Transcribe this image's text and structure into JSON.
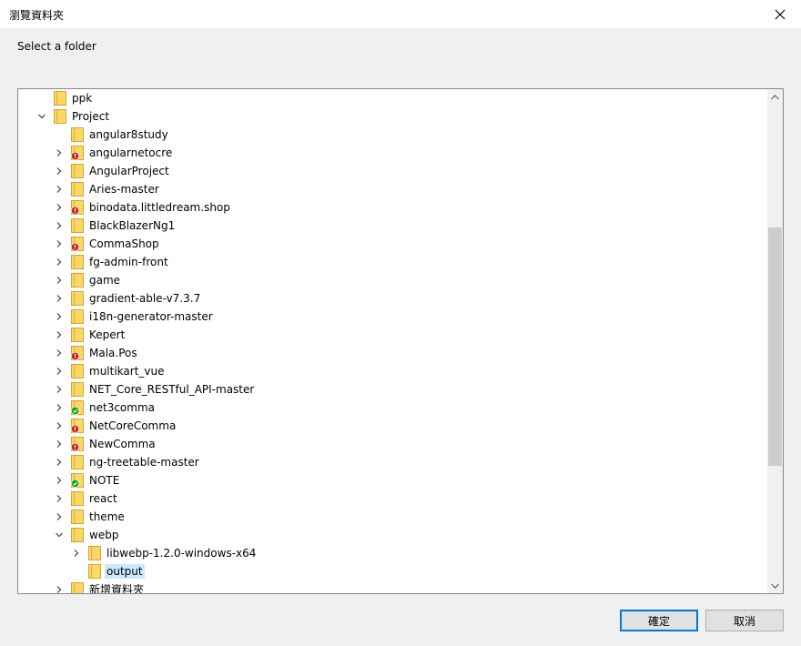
{
  "window": {
    "title": "瀏覽資料夾",
    "prompt": "Select a folder"
  },
  "tree": {
    "items": [
      {
        "label": "ppk",
        "depth": 0,
        "chevron": "none",
        "badge": "none",
        "selected": false
      },
      {
        "label": "Project",
        "depth": 0,
        "chevron": "down",
        "badge": "none",
        "selected": false
      },
      {
        "label": "angular8study",
        "depth": 1,
        "chevron": "none",
        "badge": "none",
        "selected": false
      },
      {
        "label": "angularnetocre",
        "depth": 1,
        "chevron": "right",
        "badge": "error",
        "selected": false
      },
      {
        "label": "AngularProject",
        "depth": 1,
        "chevron": "right",
        "badge": "none",
        "selected": false
      },
      {
        "label": "Aries-master",
        "depth": 1,
        "chevron": "right",
        "badge": "none",
        "selected": false
      },
      {
        "label": "binodata.littledream.shop",
        "depth": 1,
        "chevron": "right",
        "badge": "error",
        "selected": false
      },
      {
        "label": "BlackBlazerNg1",
        "depth": 1,
        "chevron": "right",
        "badge": "none",
        "selected": false
      },
      {
        "label": "CommaShop",
        "depth": 1,
        "chevron": "right",
        "badge": "error",
        "selected": false
      },
      {
        "label": "fg-admin-front",
        "depth": 1,
        "chevron": "right",
        "badge": "none",
        "selected": false
      },
      {
        "label": "game",
        "depth": 1,
        "chevron": "right",
        "badge": "none",
        "selected": false
      },
      {
        "label": "gradient-able-v7.3.7",
        "depth": 1,
        "chevron": "right",
        "badge": "none",
        "selected": false
      },
      {
        "label": "i18n-generator-master",
        "depth": 1,
        "chevron": "right",
        "badge": "none",
        "selected": false
      },
      {
        "label": "Kepert",
        "depth": 1,
        "chevron": "right",
        "badge": "none",
        "selected": false
      },
      {
        "label": "Mala.Pos",
        "depth": 1,
        "chevron": "right",
        "badge": "error",
        "selected": false
      },
      {
        "label": "multikart_vue",
        "depth": 1,
        "chevron": "right",
        "badge": "none",
        "selected": false
      },
      {
        "label": "NET_Core_RESTful_API-master",
        "depth": 1,
        "chevron": "right",
        "badge": "none",
        "selected": false
      },
      {
        "label": "net3comma",
        "depth": 1,
        "chevron": "right",
        "badge": "ok",
        "selected": false
      },
      {
        "label": "NetCoreComma",
        "depth": 1,
        "chevron": "right",
        "badge": "error",
        "selected": false
      },
      {
        "label": "NewComma",
        "depth": 1,
        "chevron": "right",
        "badge": "error",
        "selected": false
      },
      {
        "label": "ng-treetable-master",
        "depth": 1,
        "chevron": "right",
        "badge": "none",
        "selected": false
      },
      {
        "label": "NOTE",
        "depth": 1,
        "chevron": "right",
        "badge": "ok",
        "selected": false
      },
      {
        "label": "react",
        "depth": 1,
        "chevron": "right",
        "badge": "none",
        "selected": false
      },
      {
        "label": "theme",
        "depth": 1,
        "chevron": "right",
        "badge": "none",
        "selected": false
      },
      {
        "label": "webp",
        "depth": 1,
        "chevron": "down",
        "badge": "none",
        "selected": false
      },
      {
        "label": "libwebp-1.2.0-windows-x64",
        "depth": 2,
        "chevron": "right",
        "badge": "none",
        "selected": false
      },
      {
        "label": "output",
        "depth": 2,
        "chevron": "none",
        "badge": "none",
        "selected": true
      },
      {
        "label": "新增資料夾",
        "depth": 1,
        "chevron": "right",
        "badge": "none",
        "selected": false
      }
    ]
  },
  "buttons": {
    "ok": "確定",
    "cancel": "取消"
  },
  "icons": {
    "close": "close-icon",
    "folder": "folder-icon",
    "error_badge": "error-badge-icon",
    "ok_badge": "synced-badge-icon",
    "chevron_right": "chevron-right-icon",
    "chevron_down": "chevron-down-icon"
  },
  "colors": {
    "folder_fill": "#ffd766",
    "folder_stroke": "#d9a32a",
    "error_badge": "#c4281c",
    "ok_badge": "#16a30b",
    "selection": "#cce8ff",
    "accent": "#0078d7"
  }
}
